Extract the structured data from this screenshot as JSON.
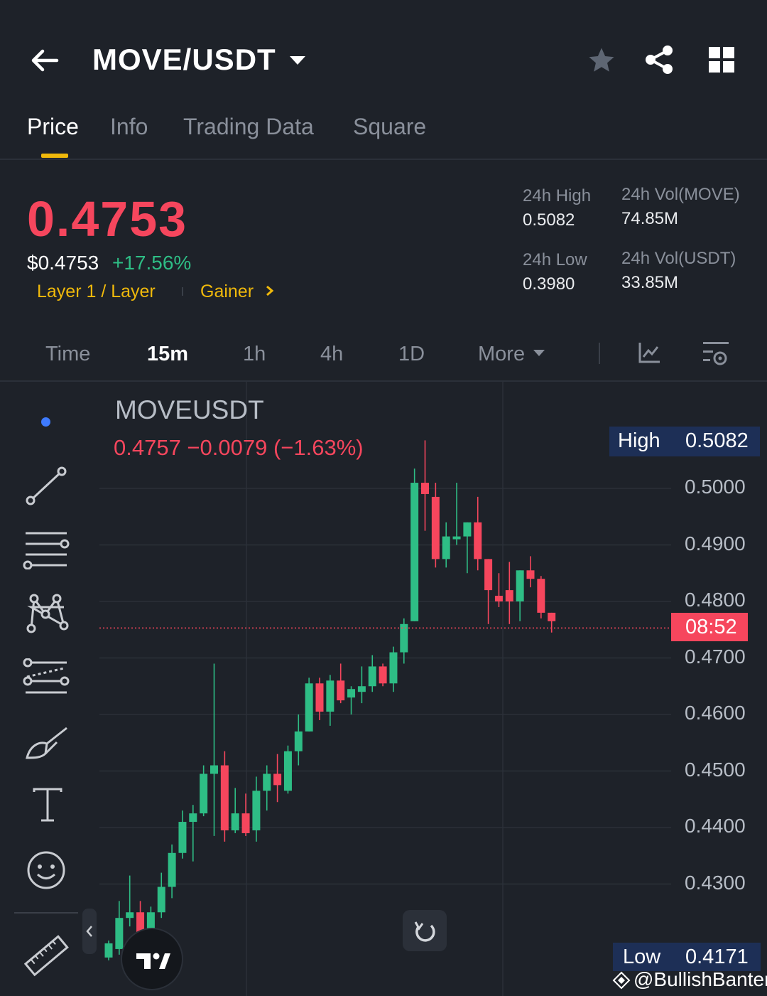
{
  "header": {
    "title": "MOVE/USDT"
  },
  "tabs": [
    {
      "label": "Price",
      "active": true
    },
    {
      "label": "Info",
      "active": false
    },
    {
      "label": "Trading Data",
      "active": false
    },
    {
      "label": "Square",
      "active": false
    }
  ],
  "ticker": {
    "last_price": "0.4753",
    "usd_price": "$0.4753",
    "change_pct": "+17.56%",
    "tag_category": "Layer 1 / Layer",
    "tag_gainer": "Gainer",
    "high_label": "24h High",
    "high_value": "0.5082",
    "low_label": "24h Low",
    "low_value": "0.3980",
    "vol_move_label": "24h Vol(MOVE)",
    "vol_move_value": "74.85M",
    "vol_usdt_label": "24h Vol(USDT)",
    "vol_usdt_value": "33.85M"
  },
  "timeframes": [
    {
      "label": "Time",
      "active": false
    },
    {
      "label": "15m",
      "active": true
    },
    {
      "label": "1h",
      "active": false
    },
    {
      "label": "4h",
      "active": false
    },
    {
      "label": "1D",
      "active": false
    },
    {
      "label": "More",
      "active": false
    }
  ],
  "chart": {
    "symbol": "MOVEUSDT",
    "ohlc_summary": "0.4757  −0.0079 (−1.63%)",
    "high_label": "High",
    "high_value": "0.5082",
    "low_label": "Low",
    "low_value": "0.4171",
    "countdown": "08:52",
    "y_labels": [
      "0.5000",
      "0.4900",
      "0.4800",
      "0.4700",
      "0.4600",
      "0.4500",
      "0.4400",
      "0.4300"
    ],
    "watermark": "@BullishBanter"
  },
  "colors": {
    "up": "#2ebd85",
    "down": "#f6465d",
    "accent": "#f0b90b",
    "bg": "#1e2229"
  },
  "chart_data": {
    "type": "candlestick",
    "symbol": "MOVEUSDT",
    "interval": "15m",
    "ylim": [
      0.418,
      0.512
    ],
    "current_price": 0.4753,
    "candles": [
      {
        "o": 0.417,
        "h": 0.42,
        "c": 0.4195,
        "l": 0.4165
      },
      {
        "o": 0.4185,
        "h": 0.427,
        "c": 0.424,
        "l": 0.4175
      },
      {
        "o": 0.424,
        "h": 0.4315,
        "c": 0.425,
        "l": 0.4225
      },
      {
        "o": 0.425,
        "h": 0.427,
        "c": 0.42,
        "l": 0.419
      },
      {
        "o": 0.4205,
        "h": 0.426,
        "c": 0.425,
        "l": 0.42
      },
      {
        "o": 0.425,
        "h": 0.432,
        "c": 0.4295,
        "l": 0.424
      },
      {
        "o": 0.4295,
        "h": 0.437,
        "c": 0.4355,
        "l": 0.4275
      },
      {
        "o": 0.4355,
        "h": 0.443,
        "c": 0.441,
        "l": 0.4345
      },
      {
        "o": 0.441,
        "h": 0.444,
        "c": 0.4425,
        "l": 0.434
      },
      {
        "o": 0.4425,
        "h": 0.451,
        "c": 0.4495,
        "l": 0.442
      },
      {
        "o": 0.4495,
        "h": 0.469,
        "c": 0.451,
        "l": 0.4385
      },
      {
        "o": 0.451,
        "h": 0.4535,
        "c": 0.4395,
        "l": 0.4375
      },
      {
        "o": 0.4395,
        "h": 0.447,
        "c": 0.4425,
        "l": 0.439
      },
      {
        "o": 0.4425,
        "h": 0.446,
        "c": 0.439,
        "l": 0.4385
      },
      {
        "o": 0.4395,
        "h": 0.449,
        "c": 0.4465,
        "l": 0.4375
      },
      {
        "o": 0.4465,
        "h": 0.451,
        "c": 0.4495,
        "l": 0.443
      },
      {
        "o": 0.4495,
        "h": 0.453,
        "c": 0.4475,
        "l": 0.4445
      },
      {
        "o": 0.4465,
        "h": 0.4545,
        "c": 0.4535,
        "l": 0.446
      },
      {
        "o": 0.4535,
        "h": 0.46,
        "c": 0.457,
        "l": 0.451
      },
      {
        "o": 0.457,
        "h": 0.4665,
        "c": 0.4655,
        "l": 0.457
      },
      {
        "o": 0.4655,
        "h": 0.4665,
        "c": 0.4605,
        "l": 0.459
      },
      {
        "o": 0.4605,
        "h": 0.467,
        "c": 0.466,
        "l": 0.458
      },
      {
        "o": 0.466,
        "h": 0.469,
        "c": 0.4625,
        "l": 0.462
      },
      {
        "o": 0.463,
        "h": 0.465,
        "c": 0.4645,
        "l": 0.46
      },
      {
        "o": 0.464,
        "h": 0.4685,
        "c": 0.465,
        "l": 0.462
      },
      {
        "o": 0.465,
        "h": 0.4705,
        "c": 0.4685,
        "l": 0.464
      },
      {
        "o": 0.4685,
        "h": 0.469,
        "c": 0.4655,
        "l": 0.465
      },
      {
        "o": 0.4655,
        "h": 0.472,
        "c": 0.471,
        "l": 0.464
      },
      {
        "o": 0.471,
        "h": 0.477,
        "c": 0.476,
        "l": 0.469
      },
      {
        "o": 0.4765,
        "h": 0.5035,
        "c": 0.501,
        "l": 0.4765
      },
      {
        "o": 0.501,
        "h": 0.5085,
        "c": 0.499,
        "l": 0.4925
      },
      {
        "o": 0.4985,
        "h": 0.501,
        "c": 0.4875,
        "l": 0.486
      },
      {
        "o": 0.4875,
        "h": 0.494,
        "c": 0.4915,
        "l": 0.486
      },
      {
        "o": 0.491,
        "h": 0.501,
        "c": 0.4915,
        "l": 0.49
      },
      {
        "o": 0.4915,
        "h": 0.4925,
        "c": 0.494,
        "l": 0.485
      },
      {
        "o": 0.494,
        "h": 0.4985,
        "c": 0.4875,
        "l": 0.4855
      },
      {
        "o": 0.4875,
        "h": 0.487,
        "c": 0.482,
        "l": 0.476
      },
      {
        "o": 0.481,
        "h": 0.485,
        "c": 0.48,
        "l": 0.479
      },
      {
        "o": 0.482,
        "h": 0.487,
        "c": 0.48,
        "l": 0.476
      },
      {
        "o": 0.48,
        "h": 0.4855,
        "c": 0.4855,
        "l": 0.4765
      },
      {
        "o": 0.4855,
        "h": 0.488,
        "c": 0.484,
        "l": 0.4825
      },
      {
        "o": 0.484,
        "h": 0.4845,
        "c": 0.478,
        "l": 0.477
      },
      {
        "o": 0.478,
        "h": 0.478,
        "c": 0.4765,
        "l": 0.4745
      }
    ]
  }
}
